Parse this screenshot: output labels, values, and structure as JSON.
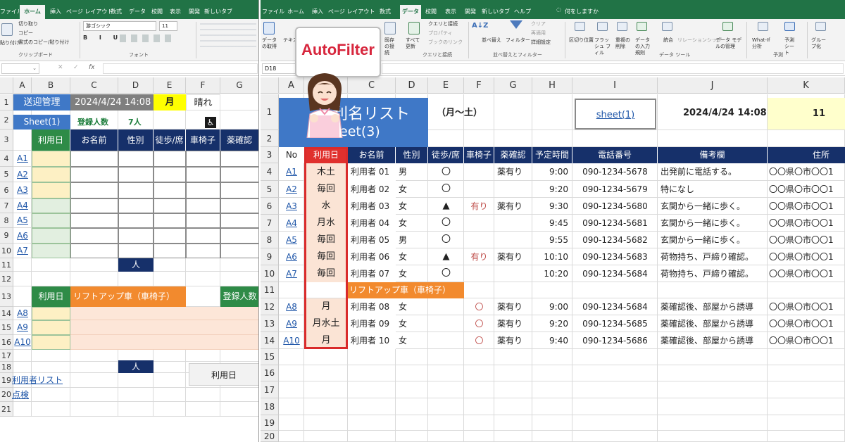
{
  "left": {
    "ribbon_tabs": [
      "ファイル",
      "ホーム",
      "挿入",
      "ページ レイアウト",
      "数式",
      "データ",
      "校閲",
      "表示",
      "開発",
      "新しいタブ"
    ],
    "clipboard": {
      "paste": "貼り付け",
      "cut": "切り取り",
      "copy": "コピー",
      "format_painter": "書式のコピー/貼り付け",
      "group": "クリップボード"
    },
    "font": {
      "name": "游ゴシック",
      "size": "11",
      "group": "フォント"
    },
    "formula_icons": {
      "cancel": "✕",
      "enter": "✓",
      "fx": "fx"
    },
    "col_headers": [
      "A",
      "B",
      "C",
      "D",
      "E",
      "F",
      "G"
    ],
    "row_labels": [
      "1",
      "2",
      "3",
      "4",
      "5",
      "6",
      "7",
      "8",
      "9",
      "10",
      "11",
      "12",
      "13",
      "14",
      "15",
      "16",
      "17",
      "18",
      "19",
      "20",
      "21"
    ],
    "title": "送迎管理",
    "datetime": "2024/4/24 14:08",
    "day": "月",
    "weather": "晴れ",
    "sheet_label": "Sheet(1)",
    "reg_label": "登録人数",
    "reg_count": "7人",
    "wheelchair_icon": "♿",
    "table_headers": [
      "利用日",
      "お名前",
      "性別",
      "徒歩/席",
      "車椅子",
      "薬確認"
    ],
    "rows": [
      "A1",
      "A2",
      "A3",
      "A4",
      "A5",
      "A6",
      "A7"
    ],
    "person_label": "人",
    "liftup_day_header": "利用日",
    "liftup_header": "リフトアップ車（車椅子）",
    "liftup_reg": "登録人数",
    "lift_rows": [
      "A8",
      "A9",
      "A10"
    ],
    "day_button": "利用日",
    "user_list_link": "利用者リスト",
    "check_link": "点検"
  },
  "right": {
    "ribbon_tabs": [
      "ファイル",
      "ホーム",
      "挿入",
      "ページ レイアウト",
      "数式",
      "データ",
      "校閲",
      "表示",
      "開発",
      "新しいタブ",
      "ヘルプ"
    ],
    "tell_me": "何をしますか",
    "ribbon": {
      "get_data": "データの取得",
      "text_csv": "テキスト",
      "refresh_all": "すべて更新",
      "existing": "既存の接続",
      "queries": "クエリと接続",
      "properties": "プロパティ",
      "edit_links": "ブックのリンク",
      "group_queries": "クエリと接続",
      "sort": "並べ替え",
      "filter": "フィルター",
      "clear": "クリア",
      "reapply": "再適用",
      "advanced": "詳細設定",
      "group_sort": "並べ替えとフィルター",
      "text_to_cols": "区切り位置",
      "flash_fill": "フラッシュ フィル",
      "remove_dup": "重複の削除",
      "validation": "データの入力規則",
      "consolidate": "統合",
      "relationships": "リレーションシップ",
      "data_model": "データ モデルの管理",
      "group_tools": "データ ツール",
      "whatif": "What-If 分析",
      "forecast": "予測シート",
      "group_forecast": "予測",
      "outline": "グループ化"
    },
    "name_box": "D18",
    "callout": "AutoFilter",
    "col_headers": [
      "A",
      "B",
      "C",
      "D",
      "E",
      "F",
      "G",
      "H",
      "I",
      "J",
      "K"
    ],
    "title_visible": "利",
    "title_visible_2": "名リスト",
    "sheet_visible": "eet(3)",
    "week_range": "（月～土）",
    "sheet_link": "sheet(1)",
    "datetime": "2024/4/24 14:08",
    "count": "11",
    "headers": [
      "No",
      "利用日",
      "お名前",
      "性別",
      "徒歩/席",
      "車椅子",
      "薬確認",
      "予定時間",
      "電話番号",
      "備考欄",
      "住所"
    ],
    "rows": [
      {
        "row": "4",
        "no": "A1",
        "day": "木土",
        "name": "利用者 01",
        "sex": "男",
        "walk": "〇",
        "wheel": "",
        "med": "薬有り",
        "time": "9:00",
        "phone": "090-1234-5678",
        "note": "出発前に電話する。",
        "addr": "〇〇県〇市〇〇1"
      },
      {
        "row": "5",
        "no": "A2",
        "day": "毎回",
        "name": "利用者 02",
        "sex": "女",
        "walk": "〇",
        "wheel": "",
        "med": "",
        "time": "9:20",
        "phone": "090-1234-5679",
        "note": "特になし",
        "addr": "〇〇県〇市〇〇1"
      },
      {
        "row": "6",
        "no": "A3",
        "day": "水",
        "name": "利用者 03",
        "sex": "女",
        "walk": "▲",
        "wheel": "有り",
        "med": "薬有り",
        "time": "9:30",
        "phone": "090-1234-5680",
        "note": "玄関から一緒に歩く。",
        "addr": "〇〇県〇市〇〇1"
      },
      {
        "row": "7",
        "no": "A4",
        "day": "月水",
        "name": "利用者 04",
        "sex": "女",
        "walk": "〇",
        "wheel": "",
        "med": "",
        "time": "9:45",
        "phone": "090-1234-5681",
        "note": "玄関から一緒に歩く。",
        "addr": "〇〇県〇市〇〇1"
      },
      {
        "row": "8",
        "no": "A5",
        "day": "毎回",
        "name": "利用者 05",
        "sex": "男",
        "walk": "〇",
        "wheel": "",
        "med": "",
        "time": "9:55",
        "phone": "090-1234-5682",
        "note": "玄関から一緒に歩く。",
        "addr": "〇〇県〇市〇〇1"
      },
      {
        "row": "9",
        "no": "A6",
        "day": "毎回",
        "name": "利用者 06",
        "sex": "女",
        "walk": "▲",
        "wheel": "有り",
        "med": "薬有り",
        "time": "10:10",
        "phone": "090-1234-5683",
        "note": "荷物持ち、戸締り確認。",
        "addr": "〇〇県〇市〇〇1"
      },
      {
        "row": "10",
        "no": "A7",
        "day": "毎回",
        "name": "利用者 07",
        "sex": "女",
        "walk": "〇",
        "wheel": "",
        "med": "",
        "time": "10:20",
        "phone": "090-1234-5684",
        "note": "荷物持ち、戸締り確認。",
        "addr": "〇〇県〇市〇〇1"
      }
    ],
    "liftup_label": "リフトアップ車（車椅子）",
    "lift_rows": [
      {
        "row": "12",
        "no": "A8",
        "day": "月",
        "name": "利用者 08",
        "sex": "女",
        "walk": "",
        "wheel": "〇",
        "med": "薬有り",
        "time": "9:00",
        "phone": "090-1234-5684",
        "note": "薬確認後、部屋から誘導",
        "addr": "〇〇県〇市〇〇1"
      },
      {
        "row": "13",
        "no": "A9",
        "day": "月水土",
        "name": "利用者 09",
        "sex": "女",
        "walk": "",
        "wheel": "〇",
        "med": "薬有り",
        "time": "9:20",
        "phone": "090-1234-5685",
        "note": "薬確認後、部屋から誘導",
        "addr": "〇〇県〇市〇〇1"
      },
      {
        "row": "14",
        "no": "A10",
        "day": "月",
        "name": "利用者 10",
        "sex": "女",
        "walk": "",
        "wheel": "〇",
        "med": "薬有り",
        "time": "9:40",
        "phone": "090-1234-5686",
        "note": "薬確認後、部屋から誘導",
        "addr": "〇〇県〇市〇〇1"
      }
    ],
    "row_labels_top": [
      "1",
      "2",
      "3"
    ],
    "row_label_11": "11",
    "row_labels_bottom": [
      "15",
      "16",
      "17",
      "18",
      "19",
      "20"
    ]
  }
}
